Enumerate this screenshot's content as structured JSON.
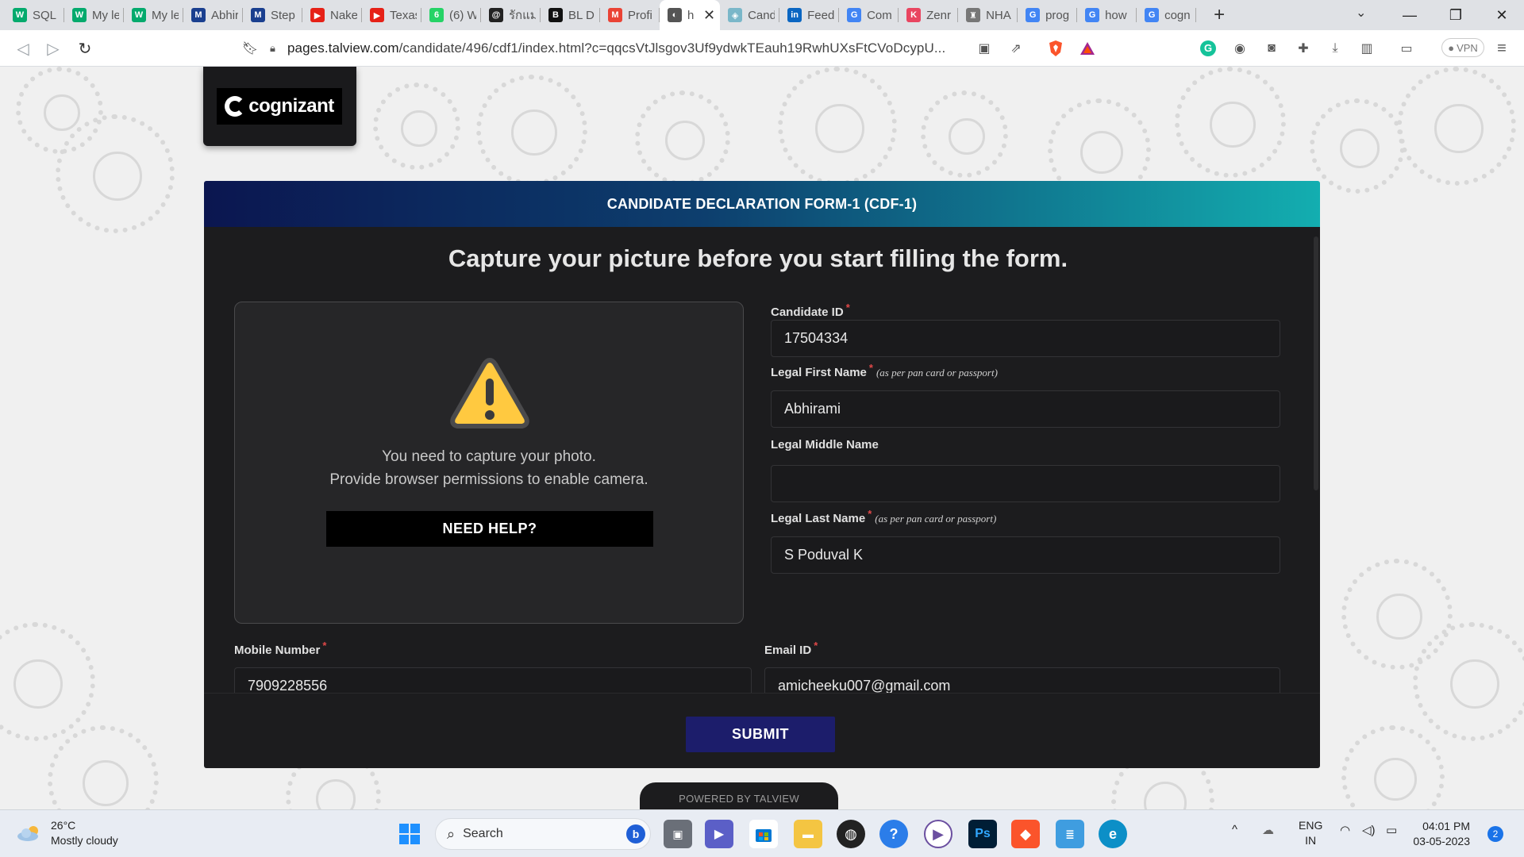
{
  "browser": {
    "tabs": [
      {
        "title": "SQL I",
        "icon": "w3schools-icon",
        "color": "#04aa6d",
        "glyph": "W"
      },
      {
        "title": "My le",
        "icon": "w3schools-icon",
        "color": "#04aa6d",
        "glyph": "W"
      },
      {
        "title": "My le",
        "icon": "w3schools-icon",
        "color": "#04aa6d",
        "glyph": "W"
      },
      {
        "title": "Abhir",
        "icon": "mdl-icon",
        "color": "#1a3f8f",
        "glyph": "M"
      },
      {
        "title": "Step",
        "icon": "mdl-icon",
        "color": "#1a3f8f",
        "glyph": "M"
      },
      {
        "title": "Nake",
        "icon": "youtube-icon",
        "color": "#e62117",
        "glyph": "▶"
      },
      {
        "title": "Texas",
        "icon": "youtube-icon",
        "color": "#e62117",
        "glyph": "▶"
      },
      {
        "title": "(6) W",
        "icon": "whatsapp-icon",
        "color": "#25d366",
        "glyph": "6"
      },
      {
        "title": "รักแม่",
        "icon": "threads-icon",
        "color": "#222222",
        "glyph": "@"
      },
      {
        "title": "BL D",
        "icon": "site-icon",
        "color": "#111111",
        "glyph": "B"
      },
      {
        "title": "Profi",
        "icon": "gmail-icon",
        "color": "#ea4335",
        "glyph": "M"
      },
      {
        "title": "h",
        "icon": "globe-icon",
        "color": "#555555",
        "glyph": "◐",
        "active": true
      },
      {
        "title": "Cand",
        "icon": "shield-icon",
        "color": "#7ab7c9",
        "glyph": "◈"
      },
      {
        "title": "Feed",
        "icon": "linkedin-icon",
        "color": "#0a66c2",
        "glyph": "in"
      },
      {
        "title": "Com",
        "icon": "google-icon",
        "color": "#4285f4",
        "glyph": "G"
      },
      {
        "title": "Zenr",
        "icon": "zenrows-icon",
        "color": "#e94560",
        "glyph": "K"
      },
      {
        "title": "NHA",
        "icon": "emblem-icon",
        "color": "#777777",
        "glyph": "♜"
      },
      {
        "title": "prog",
        "icon": "google-icon",
        "color": "#4285f4",
        "glyph": "G"
      },
      {
        "title": "how",
        "icon": "google-icon",
        "color": "#4285f4",
        "glyph": "G"
      },
      {
        "title": "cogn",
        "icon": "google-icon",
        "color": "#4285f4",
        "glyph": "G"
      }
    ],
    "url_host": "pages.talview.com",
    "url_path": "/candidate/496/cdf1/index.html?c=qqcsVtJlsgov3Uf9ydwkTEauh19RwhUXsFtCVoDcypU...",
    "vpn_label": "VPN"
  },
  "logo": {
    "text": "cognizant"
  },
  "form": {
    "header": "CANDIDATE DECLARATION FORM-1 (CDF-1)",
    "title": "Capture your picture before you start filling the form.",
    "camera": {
      "message_line1": "You need to capture your photo.",
      "message_line2": "Provide browser permissions to enable camera.",
      "help_label": "NEED HELP?"
    },
    "fields": {
      "candidate_id": {
        "label": "Candidate ID",
        "required": "*",
        "value": "17504334"
      },
      "first_name": {
        "label": "Legal First Name",
        "required": "*",
        "note": "(as per pan card or passport)",
        "value": "Abhirami"
      },
      "middle_name": {
        "label": "Legal Middle Name",
        "value": ""
      },
      "last_name": {
        "label": "Legal Last Name",
        "required": "*",
        "note": "(as per pan card or passport)",
        "value": "S Poduval K"
      },
      "mobile": {
        "label": "Mobile Number",
        "required": "*",
        "value": "7909228556"
      },
      "email": {
        "label": "Email ID",
        "required": "*",
        "value": "amicheeku007@gmail.com"
      }
    },
    "submit_label": "SUBMIT"
  },
  "powered_by": "POWERED BY TALVIEW",
  "taskbar": {
    "weather_temp": "26°C",
    "weather_desc": "Mostly cloudy",
    "search_label": "Search",
    "lang_line1": "ENG",
    "lang_line2": "IN",
    "time": "04:01 PM",
    "date": "03-05-2023",
    "notification_count": "2"
  }
}
